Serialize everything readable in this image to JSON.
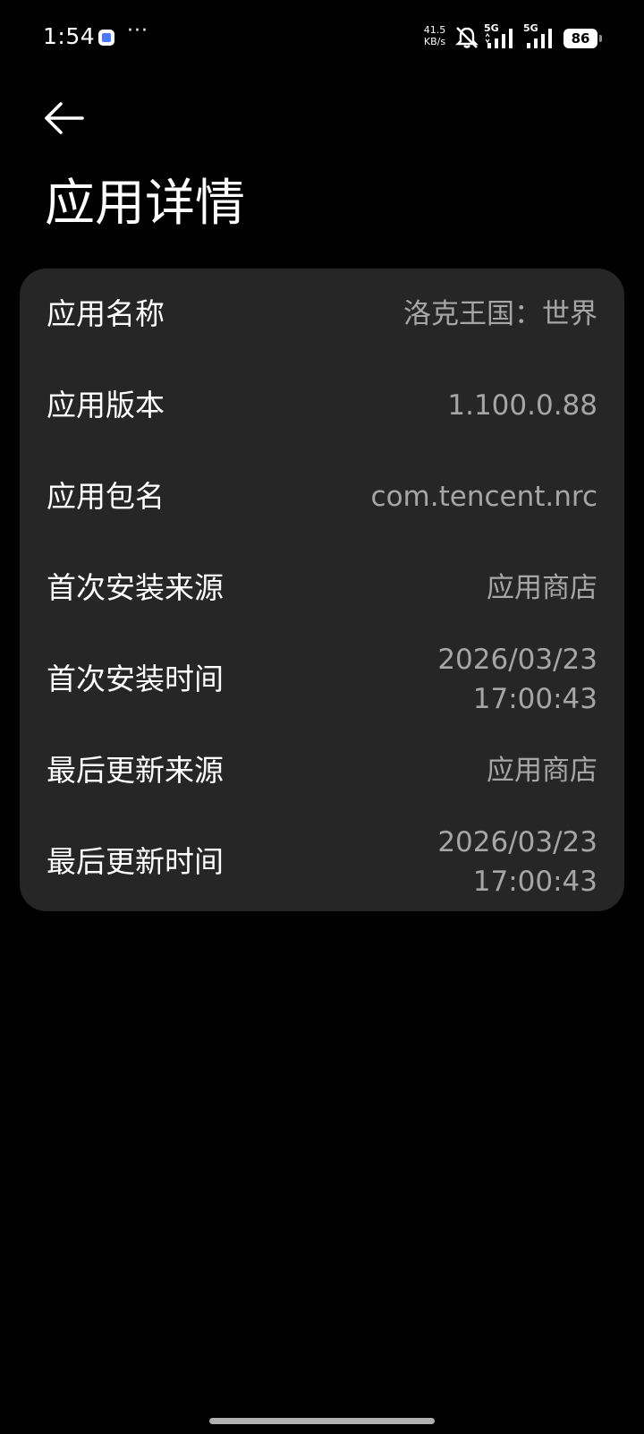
{
  "status_bar": {
    "time": "1:54",
    "more": "···",
    "net_speed_value": "41.5",
    "net_speed_unit": "KB/s",
    "sim1_network": "5G",
    "sim2_network": "5G",
    "battery": "86",
    "icons": [
      "app-notification-icon",
      "mute-icon",
      "signal-icon",
      "signal-icon",
      "battery-icon"
    ]
  },
  "header": {
    "back_icon": "arrow-left-icon",
    "title": "应用详情"
  },
  "details": {
    "rows": [
      {
        "label": "应用名称",
        "value": "洛克王国：世界"
      },
      {
        "label": "应用版本",
        "value": "1.100.0.88"
      },
      {
        "label": "应用包名",
        "value": "com.tencent.nrc"
      },
      {
        "label": "首次安装来源",
        "value": "应用商店"
      },
      {
        "label": "首次安装时间",
        "value_date": "2026/03/23",
        "value_time": "17:00:43"
      },
      {
        "label": "最后更新来源",
        "value": "应用商店"
      },
      {
        "label": "最后更新时间",
        "value_date": "2026/03/23",
        "value_time": "17:00:43"
      }
    ]
  },
  "colors": {
    "background": "#000000",
    "card": "#262626",
    "label": "#ffffff",
    "value": "#a6a6a6"
  }
}
